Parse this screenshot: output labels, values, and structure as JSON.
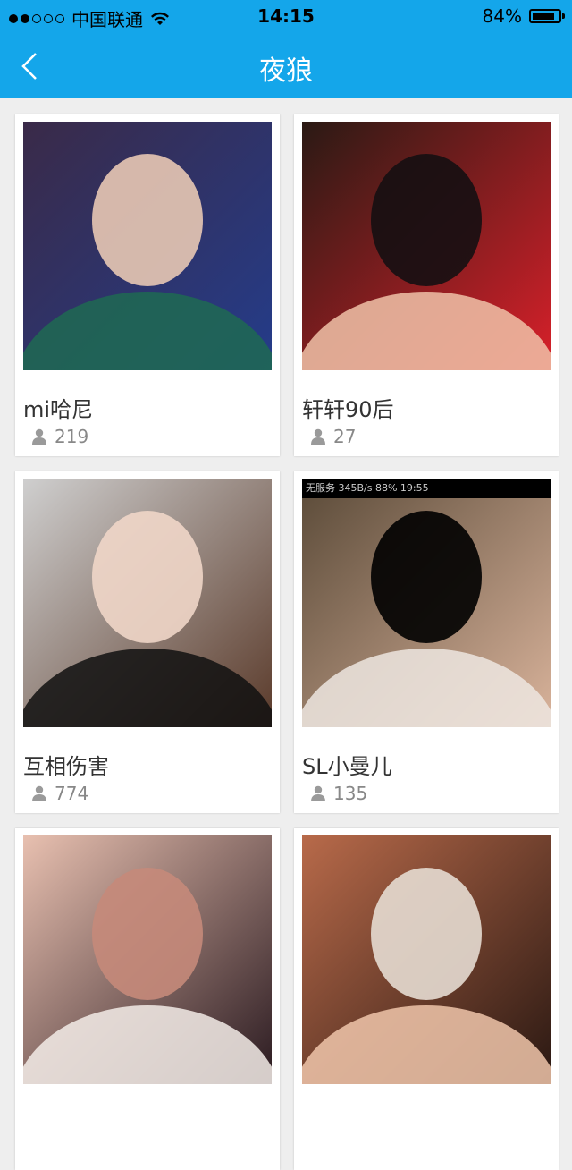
{
  "status_bar": {
    "carrier": "中国联通",
    "time": "14:15",
    "battery": "84%",
    "battery_level": 0.84
  },
  "nav": {
    "title": "夜狼",
    "back_icon": "chevron-left-icon"
  },
  "colors": {
    "accent": "#14a6ea",
    "background": "#eeeeee"
  },
  "cards": [
    {
      "name": "mi哈尼",
      "count": "219",
      "photo_palette": [
        "#3a2a48",
        "#243c8a",
        "#1f6a52",
        "#e8c8b4"
      ]
    },
    {
      "name": "轩轩90后",
      "count": "27",
      "photo_palette": [
        "#2a1a14",
        "#d8202a",
        "#f0c2a8",
        "#151012"
      ]
    },
    {
      "name": "互相伤害",
      "count": "774",
      "photo_palette": [
        "#cfcfcf",
        "#5a3a2a",
        "#111111",
        "#efd6c8"
      ]
    },
    {
      "name": "SL小曼儿",
      "count": "135",
      "photo_palette": [
        "#5a4a38",
        "#d9b39b",
        "#ede6e0",
        "#000000"
      ]
    },
    {
      "name": "",
      "count": "",
      "photo_palette": [
        "#e8c0b0",
        "#2a1a20",
        "#f3ece8",
        "#c58a7a"
      ]
    },
    {
      "name": "",
      "count": "",
      "photo_palette": [
        "#b86a4a",
        "#2a1812",
        "#f0c6aa",
        "#e6dcd2"
      ]
    }
  ],
  "screenshot_label_embedded": "无服务 345B/s 88% 19:55"
}
